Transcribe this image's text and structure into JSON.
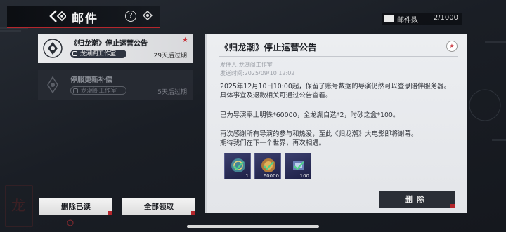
{
  "header": {
    "title": "邮件"
  },
  "mail_count": {
    "label": "邮件数",
    "value": "2/1000"
  },
  "mail_list": [
    {
      "title": "《归龙潮》停止运营公告",
      "sender": "龙潮阁工作室",
      "expire": "29天后过期",
      "selected": true,
      "starred": true
    },
    {
      "title": "停服更新补偿",
      "sender": "龙潮阁工作室",
      "expire": "5天后过期",
      "selected": false,
      "starred": false
    }
  ],
  "buttons": {
    "delete_read": "删除已读",
    "claim_all": "全部领取",
    "delete": "删除"
  },
  "detail": {
    "title": "《归龙潮》停止运营公告",
    "sender_line": "发件人:龙潮阁工作室",
    "time_line": "发送时间:2025/09/10 12:02",
    "body": [
      "2025年12月10日10:00起，保留了账号数据的导演仍然可以登录陪伴服务器。",
      "具体事宜及退款相关可通过公告查看。",
      "",
      "已为导演奉上明铢*60000，全龙胤自选*2，时砂之盒*100。",
      "",
      "再次感谢所有导演的参与和热爱，至此《归龙潮》大电影即将谢幕。",
      "期待我们在下一个世界，再次相遇。"
    ],
    "rewards": [
      {
        "icon": "dragon-token-icon",
        "qty": "1"
      },
      {
        "icon": "coin-icon",
        "qty": "60000"
      },
      {
        "icon": "hourglass-box-icon",
        "qty": "100"
      }
    ]
  },
  "colors": {
    "accent": "#b4262c",
    "panel": "#eceef1",
    "dark_button": "#2a2e36"
  }
}
